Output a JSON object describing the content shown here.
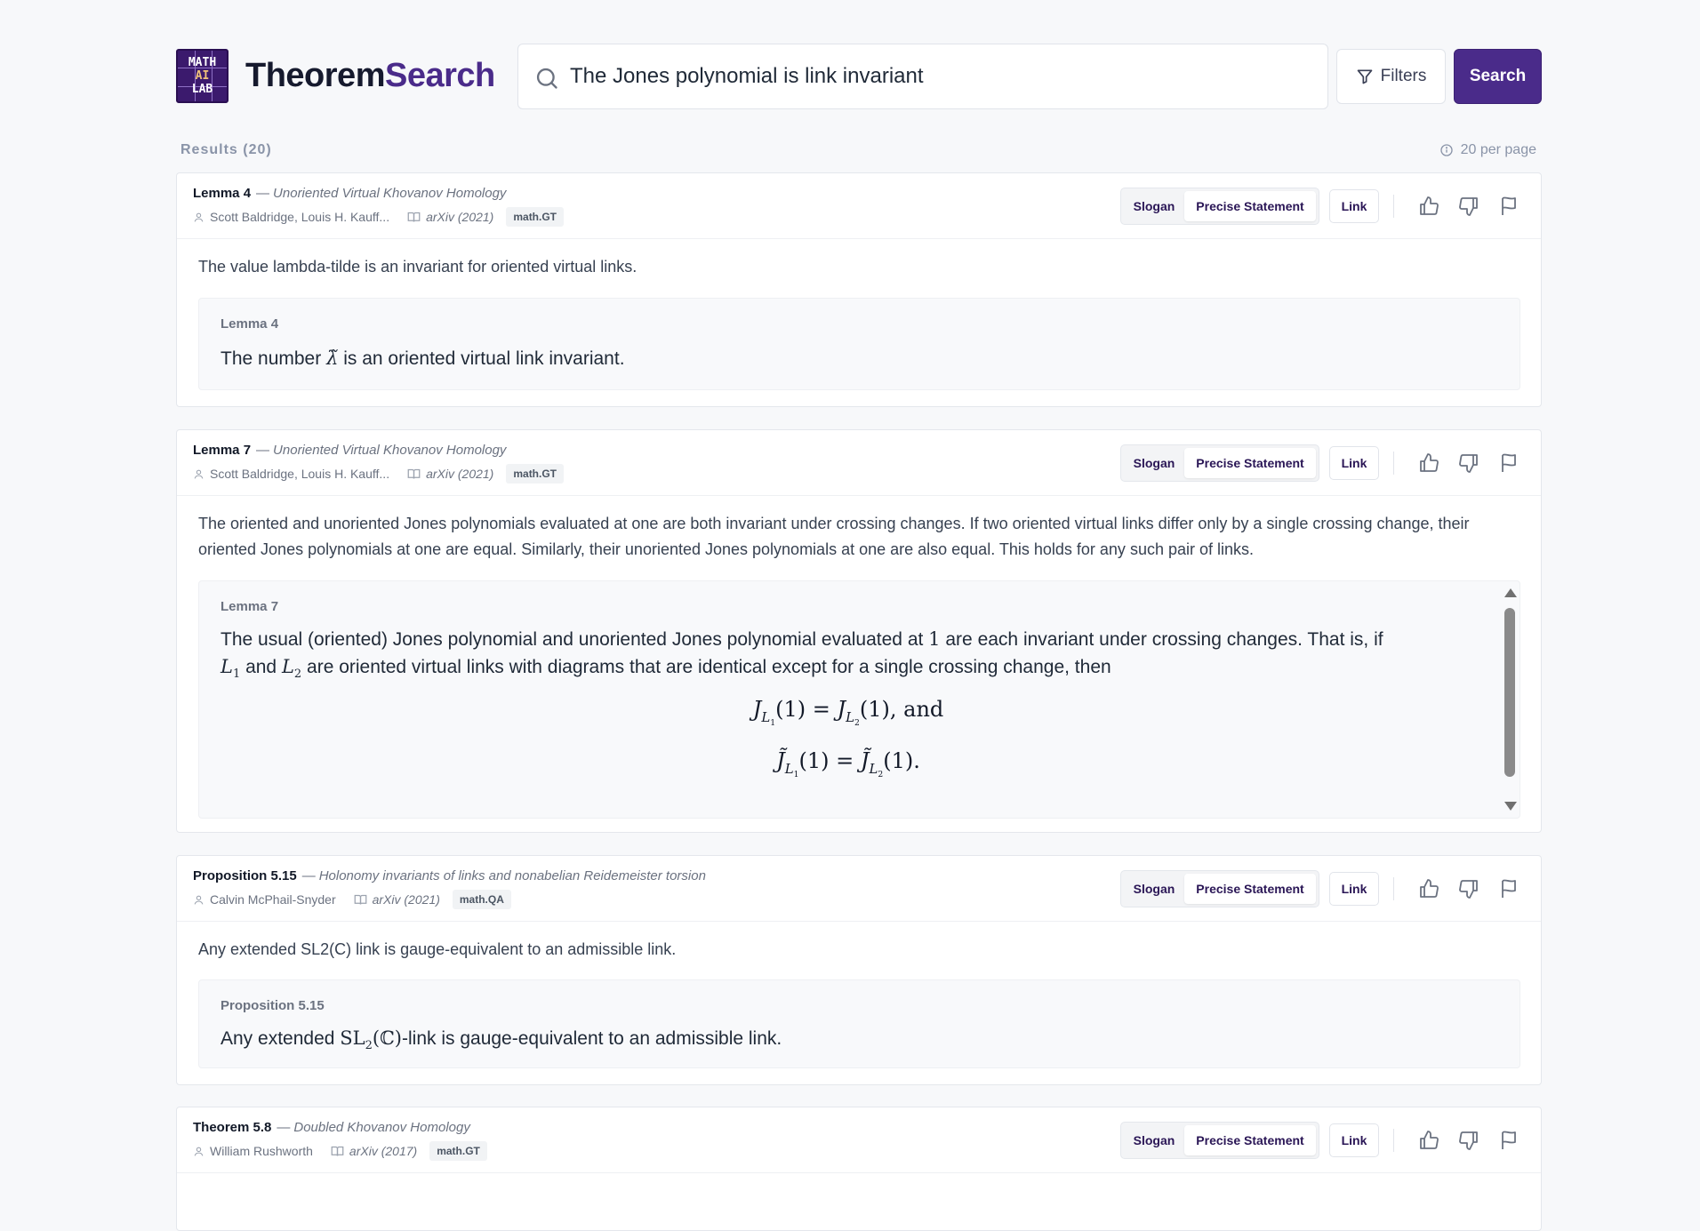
{
  "app": {
    "brand_part1": "Theorem",
    "brand_part2": "Search",
    "logo_line1": "MATH",
    "logo_line2": "AI",
    "logo_line3": "LAB",
    "accent_color": "#4a2b8a"
  },
  "search": {
    "query": "The Jones polynomial is link invariant",
    "filters_label": "Filters",
    "search_label": "Search"
  },
  "results": {
    "count_label": "Results (20)",
    "per_page_label": "20 per page"
  },
  "card_actions": {
    "slogan_tab": "Slogan",
    "precise_tab": "Precise Statement",
    "link_label": "Link"
  },
  "cards": [
    {
      "kind": "Lemma 4",
      "paper": "Unoriented Virtual Khovanov Homology",
      "authors": "Scott Baldridge, Louis H. Kauff...",
      "source": "arXiv (2021)",
      "tag": "math.GT",
      "slogan": "The value lambda-tilde is an invariant for oriented virtual links.",
      "statement_label": "Lemma 4",
      "statement_pre": "The number ",
      "statement_math": "λ̃",
      "statement_post": " is an oriented virtual link invariant."
    },
    {
      "kind": "Lemma 7",
      "paper": "Unoriented Virtual Khovanov Homology",
      "authors": "Scott Baldridge, Louis H. Kauff...",
      "source": "arXiv (2021)",
      "tag": "math.GT",
      "slogan": "The oriented and unoriented Jones polynomials evaluated at one are both invariant under crossing changes. If two oriented virtual links differ only by a single crossing change, their oriented Jones polynomials at one are equal. Similarly, their unoriented Jones polynomials at one are also equal. This holds for any such pair of links.",
      "statement_label": "Lemma 7",
      "statement_p1": "The usual (oriented) Jones polynomial and unoriented Jones polynomial evaluated at ",
      "statement_one": "1",
      "statement_p2": " are each invariant under crossing changes. That is, if",
      "statement_L": "L",
      "statement_sub1": "1",
      "statement_and": " and ",
      "statement_sub2": "2",
      "statement_p3": " are oriented virtual links with diagrams that are identical except for a single crossing change, then",
      "eq1_and": "and",
      "eq_J": "J",
      "eq_Jt": "J̃",
      "eq_arg": "(1)",
      "eq_eq": " = ",
      "eq1_tail": ",",
      "eq2_tail": "."
    },
    {
      "kind": "Proposition 5.15",
      "paper": "Holonomy invariants of links and nonabelian Reidemeister torsion",
      "authors": "Calvin McPhail-Snyder",
      "source": "arXiv (2021)",
      "tag": "math.QA",
      "slogan": "Any extended SL2(C) link is gauge-equivalent to an admissible link.",
      "statement_label": "Proposition 5.15",
      "statement_pre": "Any extended ",
      "statement_math_sl": "SL",
      "statement_math_sub": "2",
      "statement_math_c": "(ℂ)",
      "statement_post": "-link is gauge-equivalent to an admissible link."
    },
    {
      "kind": "Theorem 5.8",
      "paper": "Doubled Khovanov Homology",
      "authors": "William Rushworth",
      "source": "arXiv (2017)",
      "tag": "math.GT"
    }
  ]
}
